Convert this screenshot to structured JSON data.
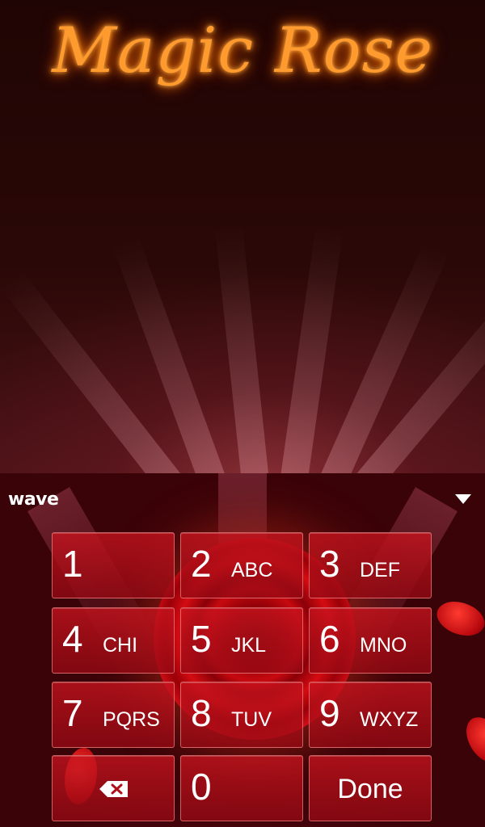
{
  "app_title": "Magic Rose",
  "keyboard": {
    "brand": "wave",
    "keys": [
      {
        "num": "1",
        "letters": ""
      },
      {
        "num": "2",
        "letters": "ABC"
      },
      {
        "num": "3",
        "letters": "DEF"
      },
      {
        "num": "4",
        "letters": "CHI"
      },
      {
        "num": "5",
        "letters": "JKL"
      },
      {
        "num": "6",
        "letters": "MNO"
      },
      {
        "num": "7",
        "letters": "PQRS"
      },
      {
        "num": "8",
        "letters": "TUV"
      },
      {
        "num": "9",
        "letters": "WXYZ"
      },
      {
        "num": "0",
        "letters": ""
      }
    ],
    "backspace_icon": "backspace-icon",
    "collapse_icon": "chevron-down-icon",
    "done_label": "Done"
  },
  "colors": {
    "title_glow": "#ff9a2e",
    "key_fill": "#c8141e",
    "background": "#1f0504"
  }
}
